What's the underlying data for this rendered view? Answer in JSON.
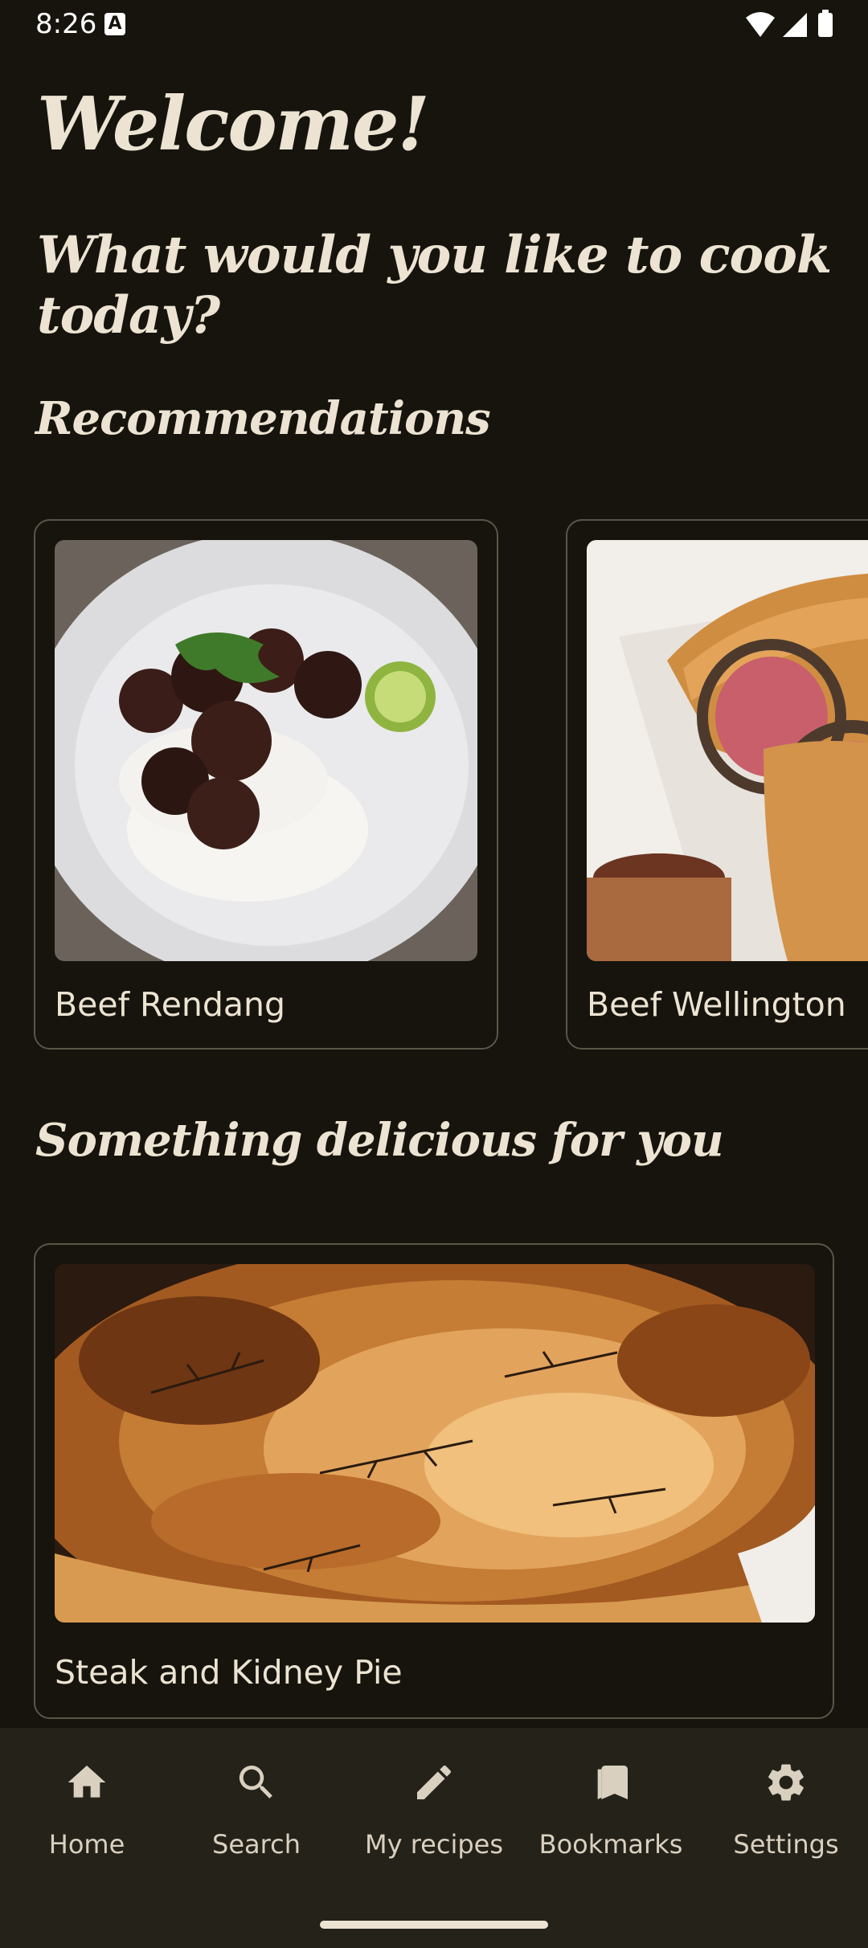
{
  "status_bar": {
    "time": "8:26",
    "notification_icon": "A"
  },
  "header": {
    "welcome": "Welcome!",
    "question": "What would you like to cook today?"
  },
  "recommendations": {
    "title": "Recommendations",
    "items": [
      {
        "name": "Beef Rendang",
        "image": "beef-rendang-photo"
      },
      {
        "name": "Beef Wellington",
        "image": "beef-wellington-photo"
      }
    ]
  },
  "featured": {
    "title": "Something delicious for you",
    "item": {
      "name": "Steak and Kidney Pie",
      "image": "steak-and-kidney-pie-photo"
    }
  },
  "nav": {
    "items": [
      {
        "label": "Home",
        "icon": "home-icon"
      },
      {
        "label": "Search",
        "icon": "search-icon"
      },
      {
        "label": "My recipes",
        "icon": "pencil-icon"
      },
      {
        "label": "Bookmarks",
        "icon": "bookmarks-icon"
      },
      {
        "label": "Settings",
        "icon": "gear-icon"
      }
    ]
  },
  "colors": {
    "background": "#16140d",
    "nav_background": "#25221a",
    "text": "#ece3d2",
    "card_border": "#5a5548"
  }
}
